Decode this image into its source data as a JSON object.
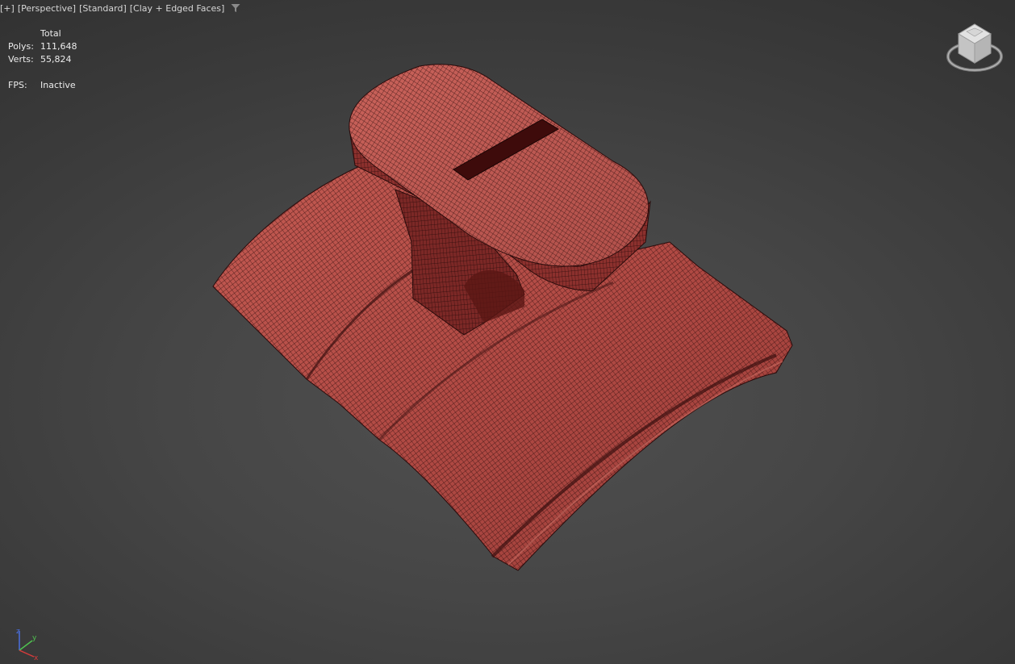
{
  "viewport": {
    "menus": [
      {
        "label": "[+]"
      },
      {
        "label": "[Perspective]"
      },
      {
        "label": "[Standard]"
      },
      {
        "label": "[Clay + Edged Faces]"
      }
    ],
    "filter_icon": "filter-icon"
  },
  "stats": {
    "header": "Total",
    "polys_label": "Polys:",
    "polys_value": "111,648",
    "verts_label": "Verts:",
    "verts_value": "55,824",
    "fps_label": "FPS:",
    "fps_value": "Inactive"
  },
  "viewcube": {
    "icon": "viewcube-icon"
  },
  "axis": {
    "x_label": "x",
    "y_label": "y",
    "z_label": "z",
    "colors": {
      "x": "#d63b3b",
      "y": "#4fc24f",
      "z": "#4a6fe0"
    }
  },
  "colors": {
    "clay": "#b8504a",
    "wire": "#2a0b0b",
    "background": "#3a3a3a"
  }
}
